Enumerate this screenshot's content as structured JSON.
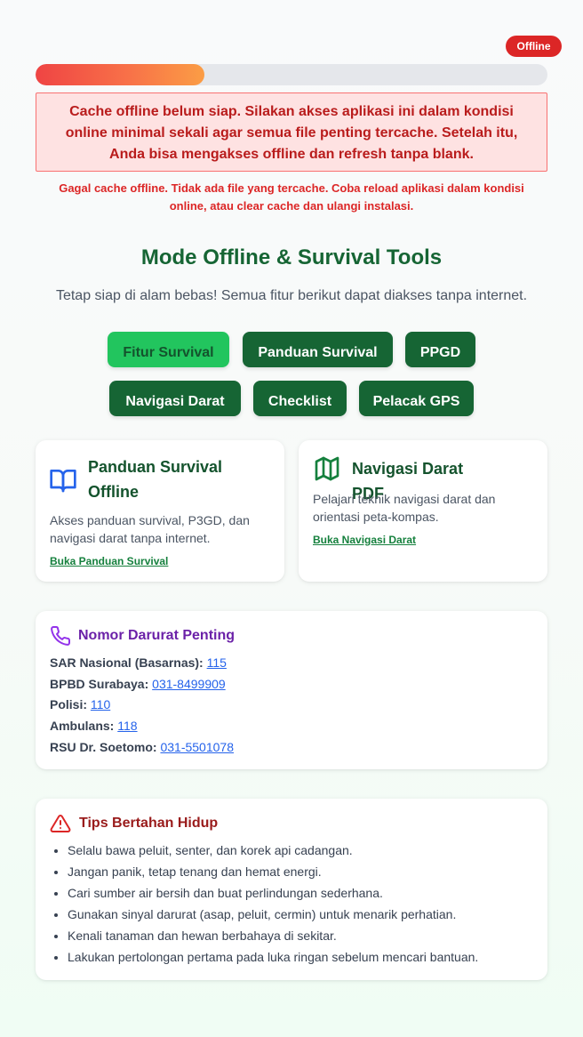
{
  "status": {
    "badge": "Offline",
    "progress_percent": 33
  },
  "alert": {
    "line1": "Cache offline belum siap. Silakan akses aplikasi ini dalam kondisi",
    "line2": "online minimal sekali agar semua file penting tercache. Setelah itu,",
    "line3": "Anda bisa mengakses offline dan refresh tanpa blank."
  },
  "cache_error": {
    "line1": "Gagal cache offline. Tidak ada file yang tercache. Coba reload aplikasi dalam kondisi",
    "line2": "online, atau clear cache dan ulangi instalasi."
  },
  "hero": {
    "title": "Mode Offline & Survival Tools",
    "subtitle": "Tetap siap di alam bebas! Semua fitur berikut dapat diakses tanpa internet."
  },
  "nav": {
    "fitur_survival": "Fitur Survival",
    "panduan_survival": "Panduan Survival",
    "ppgd": "PPGD",
    "navigasi_darat": "Navigasi Darat",
    "checklist": "Checklist",
    "pelacak_gps": "Pelacak GPS"
  },
  "cards": {
    "panduan": {
      "icon": "book-open-icon",
      "title_line1": "Panduan Survival",
      "title_line2": "Offline",
      "desc_line1": "Akses panduan survival, P3GD, dan",
      "desc_line2": "navigasi darat tanpa internet.",
      "link": "Buka Panduan Survival"
    },
    "navigasi": {
      "icon": "map-icon",
      "title_line1": "Navigasi Darat",
      "title_line2": "PDF",
      "desc_line1": "Pelajari teknik navigasi darat dan",
      "desc_line2": "orientasi peta-kompas.",
      "link": "Buka Navigasi Darat"
    }
  },
  "emergency": {
    "icon": "phone-icon",
    "title": "Nomor Darurat Penting",
    "contacts": [
      {
        "label": "SAR Nasional (Basarnas):",
        "number": "115"
      },
      {
        "label": "BPBD Surabaya:",
        "number": "031-8499909"
      },
      {
        "label": "Polisi:",
        "number": "110"
      },
      {
        "label": "Ambulans:",
        "number": "118"
      },
      {
        "label": "RSU Dr. Soetomo:",
        "number": "031-5501078"
      }
    ]
  },
  "tips": {
    "icon": "warning-triangle-icon",
    "title": "Tips Bertahan Hidup",
    "items": [
      "Selalu bawa peluit, senter, dan korek api cadangan.",
      "Jangan panik, tetap tenang dan hemat energi.",
      "Cari sumber air bersih dan buat perlindungan sederhana.",
      "Gunakan sinyal darurat (asap, peluit, cermin) untuk menarik perhatian.",
      "Kenali tanaman dan hewan berbahaya di sekitar.",
      "Lakukan pertolongan pertama pada luka ringan sebelum mencari bantuan."
    ]
  },
  "colors": {
    "primary_green": "#166534",
    "active_green": "#22c55e",
    "error_red": "#dc2626",
    "link_blue": "#2563eb",
    "emergency_purple": "#6b21a8",
    "tips_red": "#991b1b"
  }
}
